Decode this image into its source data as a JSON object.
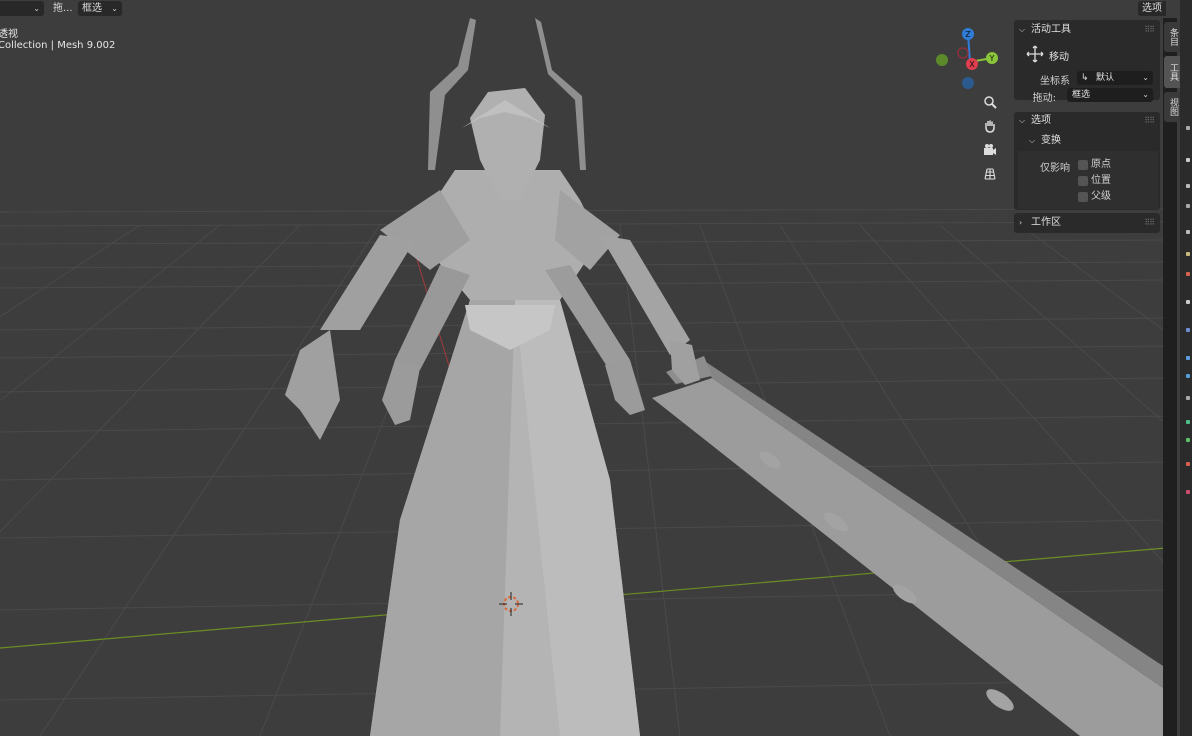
{
  "header": {
    "mode_dropdown": "",
    "drag_label": "拖...",
    "select_dropdown": "框选",
    "options_button": "选项"
  },
  "viewport": {
    "view_name": "透视",
    "collection_info": "Collection | Mesh 9.002"
  },
  "gizmo": {
    "axes": {
      "z": "Z",
      "x": "X",
      "y": "Y"
    },
    "colors": {
      "x": "#e03d4f",
      "y": "#8bc53a",
      "z": "#2f7dd8",
      "neg_y": "#5c8a2b",
      "neg_z": "#2b5a8f",
      "neg_x": "#8a2f3a"
    },
    "nav_icons": [
      "zoom-icon",
      "hand-pan-icon",
      "camera-icon",
      "grid-ortho-icon"
    ]
  },
  "sidebar": {
    "tabs": [
      "条目",
      "工具",
      "视图"
    ],
    "active_tool": {
      "title": "活动工具",
      "tool_name": "移动",
      "coord_label": "坐标系",
      "coord_value": "默认",
      "drag_label": "拖动:",
      "drag_value": "框选"
    },
    "options": {
      "title": "选项",
      "transform_title": "变换",
      "affect_only_label": "仅影响",
      "checks": [
        {
          "label": "原点",
          "checked": false
        },
        {
          "label": "位置",
          "checked": false
        },
        {
          "label": "父级",
          "checked": false
        }
      ]
    },
    "workspace": {
      "title": "工作区"
    }
  },
  "colors": {
    "viewport_bg": "#3d3d3d",
    "panel_bg": "#2a2a2a",
    "model_gray": "#a8a8a8",
    "axis_x_line": "#9a3b3b",
    "axis_y_line": "#6b8e23"
  }
}
